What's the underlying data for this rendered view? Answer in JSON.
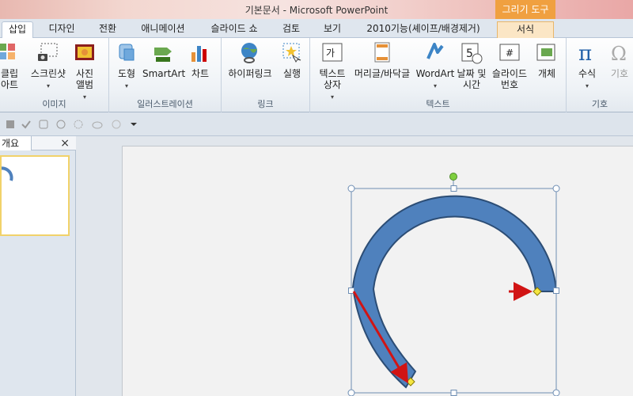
{
  "window": {
    "title": "기본문서  -  Microsoft PowerPoint",
    "contextual_tab": "그리기 도구"
  },
  "tabs": [
    {
      "label": "삽입",
      "active": true
    },
    {
      "label": "디자인"
    },
    {
      "label": "전환"
    },
    {
      "label": "애니메이션"
    },
    {
      "label": "슬라이드 쇼"
    },
    {
      "label": "검토"
    },
    {
      "label": "보기"
    },
    {
      "label": "2010기능(셰이프/배경제거)"
    },
    {
      "label": "서식",
      "contextual": true
    }
  ],
  "ribbon": {
    "groups": {
      "images": {
        "label": "이미지",
        "buttons": [
          {
            "label": "클립\n아트",
            "icon": "clip-art-icon"
          },
          {
            "label": "스크린샷",
            "icon": "screenshot-icon"
          },
          {
            "label": "사진\n앨범",
            "icon": "photo-album-icon"
          }
        ]
      },
      "illustrations": {
        "label": "일러스트레이션",
        "buttons": [
          {
            "label": "도형",
            "icon": "shapes-icon"
          },
          {
            "label": "SmartArt",
            "icon": "smartart-icon"
          },
          {
            "label": "차트",
            "icon": "chart-icon"
          }
        ]
      },
      "links": {
        "label": "링크",
        "buttons": [
          {
            "label": "하이퍼링크",
            "icon": "hyperlink-icon"
          },
          {
            "label": "실행",
            "icon": "action-icon"
          }
        ]
      },
      "text": {
        "label": "텍스트",
        "buttons": [
          {
            "label": "텍스트\n상자",
            "icon": "textbox-icon"
          },
          {
            "label": "머리글/바닥글",
            "icon": "header-footer-icon"
          },
          {
            "label": "WordArt",
            "icon": "wordart-icon"
          },
          {
            "label": "날짜 및\n시간",
            "icon": "date-time-icon"
          },
          {
            "label": "슬라이드\n번호",
            "icon": "slide-number-icon"
          },
          {
            "label": "개체",
            "icon": "object-icon"
          }
        ]
      },
      "symbols": {
        "label": "기호",
        "buttons": [
          {
            "label": "수식",
            "icon": "equation-icon"
          },
          {
            "label": "기호",
            "icon": "symbol-icon",
            "disabled": true
          }
        ]
      }
    }
  },
  "icon_glyphs": {
    "textbox": "가",
    "date": "5",
    "slide_number": "#",
    "equation": "π",
    "symbol": "Ω"
  },
  "left_pane": {
    "tab_label": "개요",
    "close_label": "×"
  },
  "colors": {
    "shape_fill": "#4f81bd",
    "shape_stroke": "#2c4d75",
    "arrow_red": "#d11414",
    "handle_green": "#7fcf3f",
    "handle_yellow": "#f5e642",
    "contextual_orange": "#f0a040"
  }
}
